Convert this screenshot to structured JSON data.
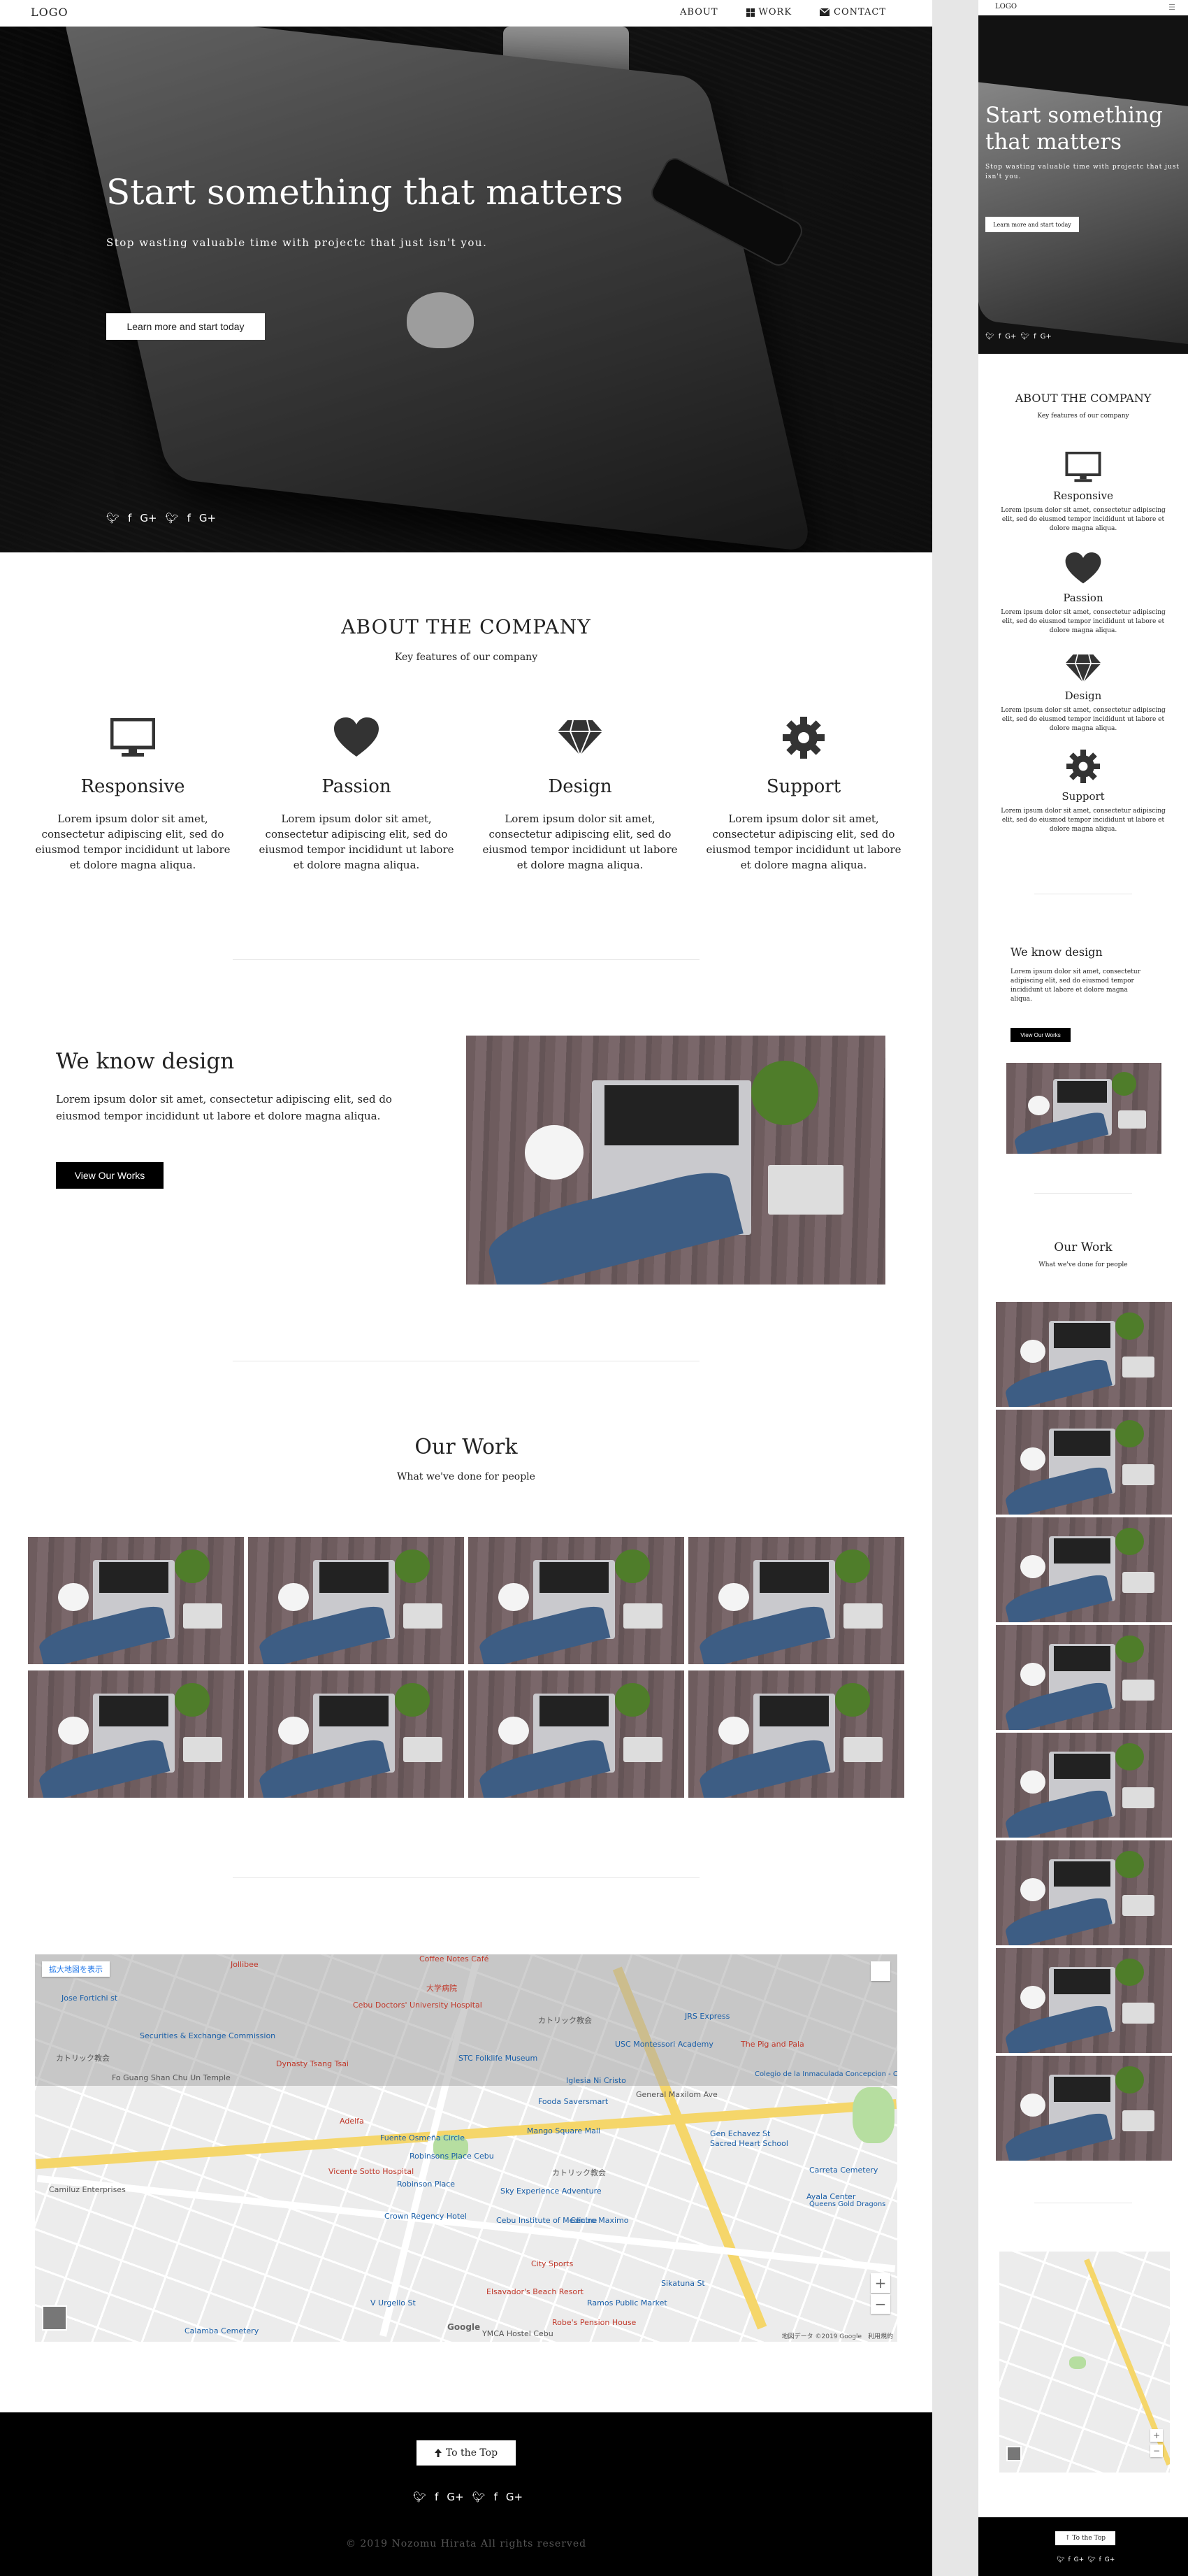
{
  "nav": {
    "logo": "LOGO",
    "links": [
      {
        "label": "ABOUT",
        "icon": "none"
      },
      {
        "label": "WORK",
        "icon": "windows-icon"
      },
      {
        "label": "CONTACT",
        "icon": "envelope-icon"
      }
    ]
  },
  "hero": {
    "title": "Start something that matters",
    "subtitle": "Stop wasting valuable time with projectc that just isn't you.",
    "cta": "Learn more and start today",
    "social": [
      "twitter-icon",
      "facebook-icon",
      "google-plus-icon",
      "twitter-icon",
      "facebook-icon",
      "google-plus-icon"
    ]
  },
  "about": {
    "title": "ABOUT THE COMPANY",
    "subtitle": "Key features of our company",
    "features": [
      {
        "icon": "monitor-icon",
        "title": "Responsive",
        "text": "Lorem ipsum dolor sit amet, consectetur adipiscing elit, sed do eiusmod tempor incididunt ut labore et dolore magna aliqua."
      },
      {
        "icon": "heart-icon",
        "title": "Passion",
        "text": "Lorem ipsum dolor sit amet, consectetur adipiscing elit, sed do eiusmod tempor incididunt ut labore et dolore magna aliqua."
      },
      {
        "icon": "diamond-icon",
        "title": "Design",
        "text": "Lorem ipsum dolor sit amet, consectetur adipiscing elit, sed do eiusmod tempor incididunt ut labore et dolore magna aliqua."
      },
      {
        "icon": "gear-icon",
        "title": "Support",
        "text": "Lorem ipsum dolor sit amet, consectetur adipiscing elit, sed do eiusmod tempor incididunt ut labore et dolore magna aliqua."
      }
    ]
  },
  "know": {
    "title": "We know design",
    "text": "Lorem ipsum dolor sit amet, consectetur adipiscing elit, sed do eiusmod tempor incididunt ut labore et dolore magna aliqua.",
    "button": "View Our Works"
  },
  "work": {
    "title": "Our Work",
    "subtitle": "What we've done for people"
  },
  "map": {
    "enlarge": "拡大地図を表示",
    "zoom_in": "+",
    "zoom_out": "−",
    "google": "Google",
    "copyright": "地図データ ©2019 Google　利用規約",
    "labels": [
      "Jollibee",
      "Coffee Notes Café",
      "大学病院",
      "Cebu Doctors' University Hospital",
      "カトリック教会",
      "Jose Fortichi st",
      "Securities & Exchange Commission",
      "JRS Express",
      "カトリック教会",
      "Fo Guang Shan Chu Un Temple",
      "Dynasty Tsang Tsai",
      "STC Folklife Museum",
      "USC Montessori Academy",
      "Iglesia Ni Cristo",
      "General Maxilom Ave",
      "Fooda Saversmart",
      "Adelfa",
      "Fuente Osmeña Circle",
      "Mango Square Mall",
      "Robinsons Place Cebu",
      "Gen Echavez St",
      "Sacred Heart School",
      "Vicente Sotto Hospital",
      "Robinson Place",
      "Sky Experience Adventure",
      "Carreta Cemetery",
      "Camiluz Enterprises",
      "Crown Regency Hotel",
      "Cebu Institute of Medicine",
      "Centro Maximo",
      "City Sports",
      "Elsavador's Beach Resort",
      "Ramos Public Market",
      "Sikatuna St",
      "Calamba Cemetery",
      "V Urgello St",
      "Robe's Pension House",
      "YMCA Hostel Cebu",
      "カトリック教会",
      "The Pig and Pala",
      "Colegio de la Inmaculada Concepcion - Cebu",
      "Ayala Center",
      "Queens Gold Dragons"
    ]
  },
  "footer": {
    "to_top": "To the Top",
    "social": [
      "twitter-icon",
      "facebook-icon",
      "google-plus-icon",
      "twitter-icon",
      "facebook-icon",
      "google-plus-icon"
    ],
    "copyright": "© 2019 Nozomu Hirata All rights reserved"
  },
  "mobile": {
    "logo": "LOGO",
    "menu_icon": "hamburger-icon",
    "hero_title": "Start something that matters",
    "hero_subtitle": "Stop wasting valuable time with projectc that just isn't you.",
    "hero_cta": "Learn more and start today",
    "about_title": "ABOUT THE COMPANY",
    "about_subtitle": "Key features of our company",
    "know_title": "We know design",
    "know_text": "Lorem ipsum dolor sit amet, consectetur adipiscing elit, sed do eiusmod tempor incididunt ut labore et dolore magna aliqua.",
    "know_button": "View Our Works",
    "work_title": "Our Work",
    "work_subtitle": "What we've done for people",
    "to_top": "To the Top"
  },
  "colors": {
    "black": "#000000",
    "white": "#ffffff",
    "text": "#222222",
    "divider": "#e6e6e6",
    "map_road": "#f5d66a",
    "map_park": "#b6dea0"
  }
}
